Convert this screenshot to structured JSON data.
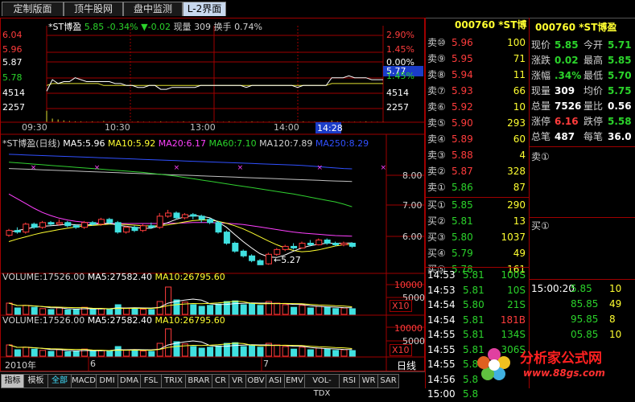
{
  "tabs": [
    "定制版面",
    "顶牛股网",
    "盘中监测",
    "L-2界面"
  ],
  "intraday": {
    "header_name": "*ST博盈",
    "header_price": "5.85",
    "header_pct": "-0.34%",
    "header_change_arrow": "▼",
    "header_change": "-0.02",
    "header_vol_label": "现量",
    "header_vol": "309",
    "header_turnover_label": "换手",
    "header_turnover": "0.74%",
    "price_ticks": [
      "6.04",
      "5.96",
      "5.87",
      "5.78"
    ],
    "pct_ticks": [
      "2.90%",
      "1.45%",
      "0.00%",
      "1.45%"
    ],
    "vol_ticks": [
      "4514",
      "2257"
    ],
    "vol_ticks_right": [
      "4514",
      "2257"
    ],
    "time_ticks": [
      "09:30",
      "10:30",
      "13:00",
      "14:00",
      "14:28"
    ],
    "price_tag": "5.77",
    "price_series": [
      5.79,
      5.85,
      5.83,
      5.84,
      5.84,
      5.86,
      5.85,
      5.84,
      5.84,
      5.84,
      5.84,
      5.84,
      5.83,
      5.83,
      5.82,
      5.82,
      5.81,
      5.81,
      5.82,
      5.82,
      5.8,
      5.8,
      5.81,
      5.81,
      5.81,
      5.81,
      5.81,
      5.82,
      5.82,
      5.82,
      5.82,
      5.82,
      5.82,
      5.82,
      5.82,
      5.81,
      5.82,
      5.82,
      5.82,
      5.82,
      5.82,
      5.82,
      5.82,
      5.82,
      5.81,
      5.82,
      5.82,
      5.82,
      5.82,
      5.82,
      5.86,
      5.86,
      5.86,
      5.87,
      5.86,
      5.86,
      5.86,
      5.85,
      5.85,
      5.85
    ],
    "avg_series": [
      5.82,
      5.83,
      5.83,
      5.83,
      5.83,
      5.83,
      5.83,
      5.83,
      5.83,
      5.83,
      5.82,
      5.82,
      5.82,
      5.82,
      5.82,
      5.82,
      5.82,
      5.82,
      5.82,
      5.82,
      5.82,
      5.82,
      5.82,
      5.82,
      5.82,
      5.82,
      5.82,
      5.82,
      5.82,
      5.82,
      5.82,
      5.82,
      5.82,
      5.82,
      5.82,
      5.82,
      5.82,
      5.82,
      5.82,
      5.82,
      5.82,
      5.82,
      5.82,
      5.82,
      5.82,
      5.82,
      5.82,
      5.82,
      5.82,
      5.82,
      5.83,
      5.83,
      5.83,
      5.83,
      5.83,
      5.83,
      5.83,
      5.83,
      5.83,
      5.83
    ],
    "vol_series": [
      3800,
      1200,
      900,
      600,
      400,
      300,
      300,
      200,
      300,
      200,
      400,
      200,
      200,
      300,
      200,
      200,
      300,
      200,
      200,
      200,
      300,
      200,
      200,
      200,
      300,
      200,
      200,
      200,
      200,
      300,
      200,
      200,
      300,
      200,
      200,
      200,
      300,
      200,
      200,
      200,
      200,
      300,
      200,
      200,
      200,
      300,
      200,
      200,
      200,
      200,
      600,
      300,
      200,
      200,
      200,
      200,
      300,
      200,
      200,
      200
    ]
  },
  "daily": {
    "title": "*ST博盈(日线)",
    "ma5": "MA5:5.96",
    "ma10": "MA10:5.92",
    "ma20": "MA20:6.17",
    "ma60": "MA60:7.10",
    "ma120": "MA120:7.89",
    "ma250": "MA250:8.29",
    "price_ticks": [
      "8.00",
      "7.00",
      "6.00"
    ],
    "low_label": "←5.27",
    "colors": {
      "ma5": "#ffffff",
      "ma10": "#ffff30",
      "ma20": "#ff40ff",
      "ma60": "#30d030",
      "ma120": "#c0c0c0",
      "ma250": "#3050ff"
    },
    "candles": [
      [
        6.2,
        6.35,
        6.15,
        6.4
      ],
      [
        6.35,
        6.3,
        6.25,
        6.45
      ],
      [
        6.3,
        6.55,
        6.25,
        6.6
      ],
      [
        6.55,
        6.45,
        6.4,
        6.6
      ],
      [
        6.45,
        6.6,
        6.4,
        6.65
      ],
      [
        6.6,
        6.55,
        6.5,
        6.65
      ],
      [
        6.55,
        6.6,
        6.5,
        6.7
      ],
      [
        6.6,
        6.5,
        6.45,
        6.65
      ],
      [
        6.5,
        6.45,
        6.4,
        6.55
      ],
      [
        6.45,
        6.6,
        6.4,
        6.65
      ],
      [
        6.6,
        6.55,
        6.5,
        6.65
      ],
      [
        6.55,
        6.7,
        6.5,
        6.75
      ],
      [
        6.7,
        6.6,
        6.55,
        6.75
      ],
      [
        6.6,
        6.3,
        6.25,
        6.65
      ],
      [
        6.3,
        6.45,
        6.25,
        6.5
      ],
      [
        6.45,
        6.35,
        6.3,
        6.5
      ],
      [
        6.35,
        6.5,
        6.3,
        6.55
      ],
      [
        6.5,
        6.45,
        6.4,
        6.6
      ],
      [
        6.45,
        6.8,
        6.4,
        6.9
      ],
      [
        6.8,
        6.9,
        6.75,
        7.0
      ],
      [
        6.9,
        6.75,
        6.7,
        6.95
      ],
      [
        6.75,
        6.85,
        6.7,
        6.9
      ],
      [
        6.85,
        6.8,
        6.7,
        6.9
      ],
      [
        6.8,
        6.7,
        6.6,
        6.85
      ],
      [
        6.7,
        6.6,
        6.55,
        6.75
      ],
      [
        6.6,
        6.3,
        6.25,
        6.65
      ],
      [
        6.3,
        5.95,
        5.9,
        6.35
      ],
      [
        5.95,
        5.7,
        5.65,
        6.0
      ],
      [
        5.7,
        5.55,
        5.5,
        5.75
      ],
      [
        5.55,
        5.4,
        5.35,
        5.6
      ],
      [
        5.4,
        5.27,
        5.27,
        5.45
      ],
      [
        5.3,
        5.6,
        5.27,
        5.65
      ],
      [
        5.6,
        5.75,
        5.55,
        5.8
      ],
      [
        5.75,
        5.85,
        5.7,
        5.9
      ],
      [
        5.85,
        5.8,
        5.75,
        5.95
      ],
      [
        5.8,
        5.95,
        5.78,
        6.0
      ],
      [
        5.95,
        5.9,
        5.85,
        6.05
      ],
      [
        5.9,
        6.05,
        5.88,
        6.1
      ],
      [
        6.05,
        5.95,
        5.9,
        6.1
      ],
      [
        5.95,
        5.9,
        5.85,
        6.0
      ],
      [
        5.9,
        5.95,
        5.85,
        6.0
      ],
      [
        5.95,
        5.85,
        5.8,
        5.98
      ]
    ],
    "ma5_series": [
      6.3,
      6.35,
      6.4,
      6.45,
      6.48,
      6.5,
      6.52,
      6.55,
      6.53,
      6.52,
      6.54,
      6.56,
      6.58,
      6.52,
      6.48,
      6.45,
      6.42,
      6.42,
      6.5,
      6.6,
      6.7,
      6.78,
      6.82,
      6.8,
      6.75,
      6.62,
      6.45,
      6.22,
      6.0,
      5.8,
      5.62,
      5.52,
      5.5,
      5.58,
      5.7,
      5.8,
      5.87,
      5.92,
      5.95,
      5.95,
      5.95,
      5.96
    ],
    "ma10_series": [
      6.0,
      6.08,
      6.15,
      6.22,
      6.28,
      6.33,
      6.38,
      6.42,
      6.46,
      6.49,
      6.51,
      6.53,
      6.55,
      6.55,
      6.54,
      6.52,
      6.5,
      6.49,
      6.5,
      6.53,
      6.57,
      6.62,
      6.66,
      6.68,
      6.68,
      6.64,
      6.58,
      6.5,
      6.4,
      6.28,
      6.15,
      6.02,
      5.9,
      5.8,
      5.72,
      5.68,
      5.7,
      5.74,
      5.8,
      5.86,
      5.9,
      5.92
    ],
    "ma20_series": [
      7.5,
      7.35,
      7.2,
      7.05,
      6.92,
      6.82,
      6.74,
      6.68,
      6.64,
      6.61,
      6.59,
      6.58,
      6.57,
      6.57,
      6.57,
      6.57,
      6.57,
      6.57,
      6.57,
      6.58,
      6.58,
      6.59,
      6.6,
      6.6,
      6.6,
      6.59,
      6.58,
      6.56,
      6.54,
      6.5,
      6.46,
      6.42,
      6.38,
      6.34,
      6.3,
      6.27,
      6.25,
      6.23,
      6.21,
      6.19,
      6.18,
      6.17
    ],
    "ma60_series": [
      8.5,
      8.48,
      8.46,
      8.44,
      8.42,
      8.4,
      8.38,
      8.36,
      8.34,
      8.32,
      8.3,
      8.28,
      8.26,
      8.24,
      8.22,
      8.2,
      8.18,
      8.15,
      8.12,
      8.09,
      8.06,
      8.02,
      7.98,
      7.94,
      7.9,
      7.86,
      7.82,
      7.78,
      7.74,
      7.7,
      7.66,
      7.62,
      7.58,
      7.54,
      7.5,
      7.45,
      7.4,
      7.35,
      7.3,
      7.25,
      7.18,
      7.1
    ],
    "ma120_series": [
      8.3,
      8.29,
      8.28,
      8.27,
      8.26,
      8.25,
      8.24,
      8.23,
      8.22,
      8.21,
      8.2,
      8.19,
      8.18,
      8.17,
      8.16,
      8.15,
      8.14,
      8.13,
      8.12,
      8.11,
      8.1,
      8.09,
      8.08,
      8.07,
      8.06,
      8.05,
      8.04,
      8.03,
      8.02,
      8.01,
      8.0,
      7.99,
      7.98,
      7.97,
      7.96,
      7.95,
      7.94,
      7.93,
      7.92,
      7.91,
      7.9,
      7.89
    ],
    "ma250_series": [
      8.75,
      8.74,
      8.73,
      8.72,
      8.71,
      8.7,
      8.69,
      8.68,
      8.67,
      8.66,
      8.65,
      8.64,
      8.63,
      8.62,
      8.61,
      8.6,
      8.59,
      8.58,
      8.57,
      8.56,
      8.55,
      8.54,
      8.53,
      8.52,
      8.51,
      8.5,
      8.49,
      8.48,
      8.47,
      8.46,
      8.45,
      8.44,
      8.43,
      8.42,
      8.41,
      8.4,
      8.38,
      8.36,
      8.34,
      8.32,
      8.3,
      8.29
    ],
    "volumes": [
      35000,
      20000,
      28000,
      22000,
      18000,
      15000,
      20000,
      14000,
      16000,
      22000,
      15000,
      18000,
      16000,
      30000,
      20000,
      18000,
      16000,
      15000,
      40000,
      85000,
      45000,
      38000,
      30000,
      25000,
      28000,
      32000,
      40000,
      42000,
      30000,
      35000,
      28000,
      40000,
      35000,
      30000,
      22000,
      28000,
      20000,
      25000,
      22000,
      18000,
      20000,
      17526
    ]
  },
  "volume_panels": [
    {
      "label": "VOLUME:17526.00",
      "ma5": "MA5:27582.40",
      "ma10": "MA10:26795.60",
      "tick": "10000",
      "tick2": "5000",
      "unit": "X10"
    },
    {
      "label": "VOLUME:17526.00",
      "ma5": "MA5:27582.40",
      "ma10": "MA10:26795.60",
      "tick": "10000",
      "tick2": "5000",
      "unit": "X10"
    }
  ],
  "date_axis": {
    "year": "2010年",
    "month6": "6",
    "month7": "7"
  },
  "bottom_toolbar": [
    "指标",
    "模板",
    "全部",
    "MACD",
    "DMI",
    "DMA",
    "FSL",
    "TRIX",
    "BRAR",
    "CR",
    "VR",
    "OBV",
    "ASI",
    "EMV",
    "VOL-TDX",
    "RSI",
    "WR",
    "SAR"
  ],
  "period_label": "日线",
  "order_book": {
    "code_title": "000760 *ST博",
    "asks": [
      {
        "label": "卖⑩",
        "price": "5.96",
        "vol": "100"
      },
      {
        "label": "卖⑨",
        "price": "5.95",
        "vol": "71"
      },
      {
        "label": "卖⑧",
        "price": "5.94",
        "vol": "11"
      },
      {
        "label": "卖⑦",
        "price": "5.93",
        "vol": "66"
      },
      {
        "label": "卖⑥",
        "price": "5.92",
        "vol": "10"
      },
      {
        "label": "卖⑤",
        "price": "5.90",
        "vol": "293"
      },
      {
        "label": "卖④",
        "price": "5.89",
        "vol": "60"
      },
      {
        "label": "卖③",
        "price": "5.88",
        "vol": "4"
      },
      {
        "label": "卖②",
        "price": "5.87",
        "vol": "328"
      },
      {
        "label": "卖①",
        "price": "5.86",
        "vol": "87"
      }
    ],
    "bids": [
      {
        "label": "买①",
        "price": "5.85",
        "vol": "290"
      },
      {
        "label": "买②",
        "price": "5.81",
        "vol": "13"
      },
      {
        "label": "买③",
        "price": "5.80",
        "vol": "1037"
      },
      {
        "label": "买④",
        "price": "5.79",
        "vol": "49"
      },
      {
        "label": "买⑤",
        "price": "5.78",
        "vol": "161"
      }
    ],
    "ticks": [
      {
        "time": "14:53",
        "price": "5.81",
        "vol": "100S"
      },
      {
        "time": "14:53",
        "price": "5.81",
        "vol": "10S"
      },
      {
        "time": "14:54",
        "price": "5.80",
        "vol": "21S"
      },
      {
        "time": "14:54",
        "price": "5.81",
        "vol": "181B"
      },
      {
        "time": "14:55",
        "price": "5.81",
        "vol": "134S"
      },
      {
        "time": "14:55",
        "price": "5.81",
        "vol": "306S"
      },
      {
        "time": "14:55",
        "price": "5.8",
        "vol": ""
      },
      {
        "time": "14:56",
        "price": "5.8",
        "vol": ""
      },
      {
        "time": "15:00",
        "price": "5.8",
        "vol": ""
      }
    ]
  },
  "quote": {
    "code_title": "000760 *ST博盈",
    "rows": [
      [
        {
          "k": "现价",
          "v": "5.85",
          "c": "grn"
        },
        {
          "k": "今开",
          "v": "5.71",
          "c": "grn"
        }
      ],
      [
        {
          "k": "涨跌",
          "v": "0.02",
          "c": "grn"
        },
        {
          "k": "最高",
          "v": "5.85",
          "c": "grn"
        }
      ],
      [
        {
          "k": "涨幅",
          "v": ".34%",
          "c": "grn"
        },
        {
          "k": "最低",
          "v": "5.70",
          "c": "grn"
        }
      ],
      [
        {
          "k": "现量",
          "v": "309",
          "c": "wht"
        },
        {
          "k": "均价",
          "v": "5.75",
          "c": "grn"
        }
      ],
      [
        {
          "k": "总量",
          "v": "7526",
          "c": "wht"
        },
        {
          "k": "量比",
          "v": "0.56",
          "c": "wht"
        }
      ],
      [
        {
          "k": "涨停",
          "v": "6.16",
          "c": "red"
        },
        {
          "k": "跌停",
          "v": "5.58",
          "c": "grn"
        }
      ],
      [
        {
          "k": "总笔",
          "v": "487",
          "c": "wht"
        },
        {
          "k": "每笔",
          "v": "36.0",
          "c": "wht"
        }
      ]
    ],
    "sell1": "卖①",
    "buy1": "买①",
    "trades": [
      {
        "time": "15:00:20",
        "price": "5.85",
        "vol": "10"
      },
      {
        "time": "",
        "price": "85.85",
        "vol": "49"
      },
      {
        "time": "",
        "price": "95.85",
        "vol": "8"
      },
      {
        "time": "",
        "price": "05.85",
        "vol": "10"
      }
    ]
  },
  "watermark": {
    "title": "分析家公式网",
    "url": "www.88gs.com"
  }
}
